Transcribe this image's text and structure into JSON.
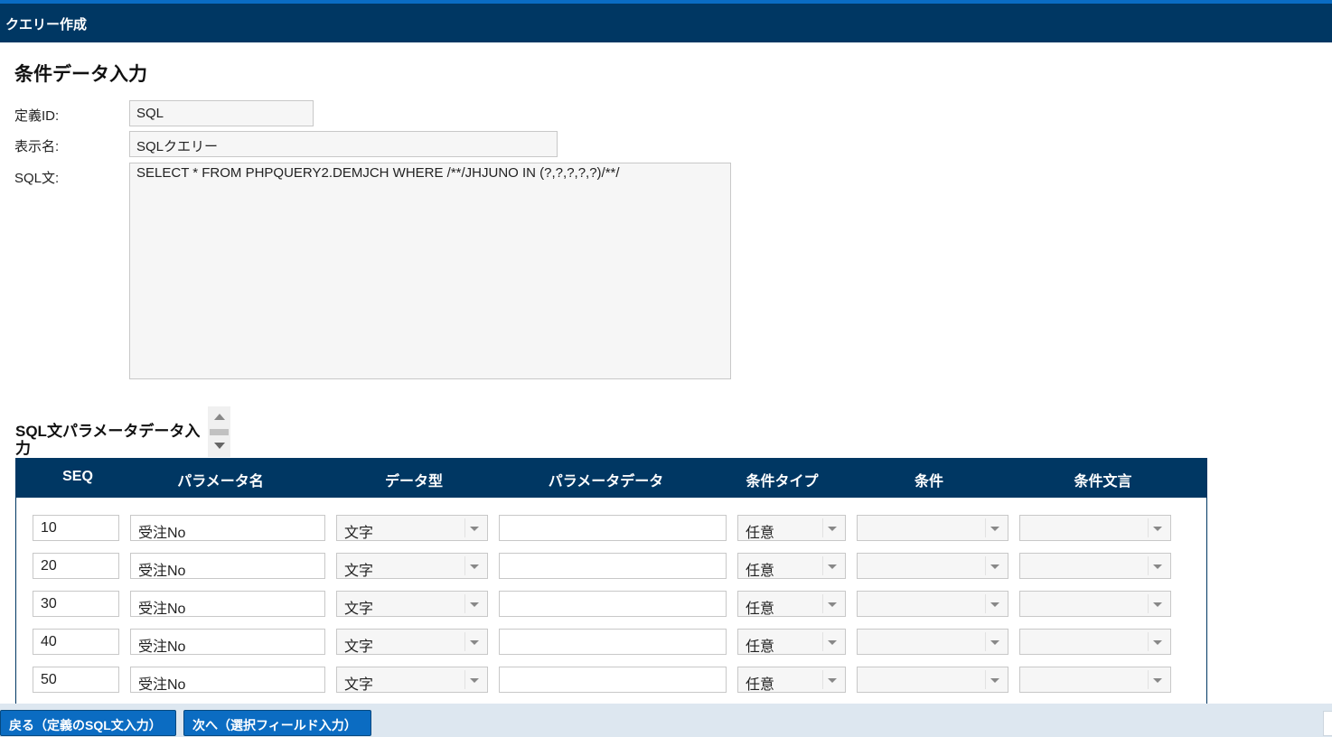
{
  "window": {
    "title": "クエリー作成"
  },
  "page": {
    "heading": "条件データ入力"
  },
  "form": {
    "definition_id_label": "定義ID:",
    "definition_id_value": "SQL",
    "display_name_label": "表示名:",
    "display_name_value": "SQLクエリー",
    "sql_label": "SQL文:",
    "sql_value": "SELECT * FROM PHPQUERY2.DEMJCH WHERE /**/JHJUNO IN (?,?,?,?,?)/**/"
  },
  "params": {
    "section_title": "SQL文パラメータデータ入力",
    "columns": [
      "SEQ",
      "パラメータ名",
      "データ型",
      "パラメータデータ",
      "条件タイプ",
      "条件",
      "条件文言"
    ],
    "rows": [
      {
        "seq": "10",
        "name": "受注No",
        "type": "文字",
        "data": "",
        "cond_type": "任意",
        "cond": "",
        "cond_text": ""
      },
      {
        "seq": "20",
        "name": "受注No",
        "type": "文字",
        "data": "",
        "cond_type": "任意",
        "cond": "",
        "cond_text": ""
      },
      {
        "seq": "30",
        "name": "受注No",
        "type": "文字",
        "data": "",
        "cond_type": "任意",
        "cond": "",
        "cond_text": ""
      },
      {
        "seq": "40",
        "name": "受注No",
        "type": "文字",
        "data": "",
        "cond_type": "任意",
        "cond": "",
        "cond_text": ""
      },
      {
        "seq": "50",
        "name": "受注No",
        "type": "文字",
        "data": "",
        "cond_type": "任意",
        "cond": "",
        "cond_text": ""
      }
    ]
  },
  "footer": {
    "back_label": "戻る（定義のSQL文入力）",
    "next_label": "次へ（選択フィールド入力）"
  },
  "colors": {
    "header_bg": "#003763",
    "accent_line": "#0a6cc4",
    "button_bg": "#0b6cc2",
    "footer_bg": "#dde7f0"
  }
}
